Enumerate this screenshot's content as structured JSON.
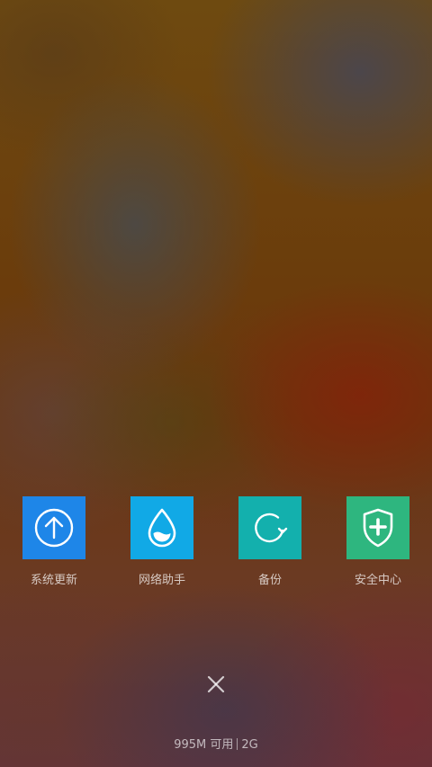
{
  "tiles": [
    {
      "label": "系统更新",
      "icon": "arrow-up-circle-icon",
      "color": "#1e86e8"
    },
    {
      "label": "网络助手",
      "icon": "water-drop-icon",
      "color": "#11a9e6"
    },
    {
      "label": "备份",
      "icon": "refresh-circle-icon",
      "color": "#13b0ad"
    },
    {
      "label": "安全中心",
      "icon": "shield-plus-icon",
      "color": "#2eb67f"
    }
  ],
  "close": {
    "icon": "close-icon"
  },
  "memory": {
    "available": "995M 可用",
    "total": "2G"
  }
}
